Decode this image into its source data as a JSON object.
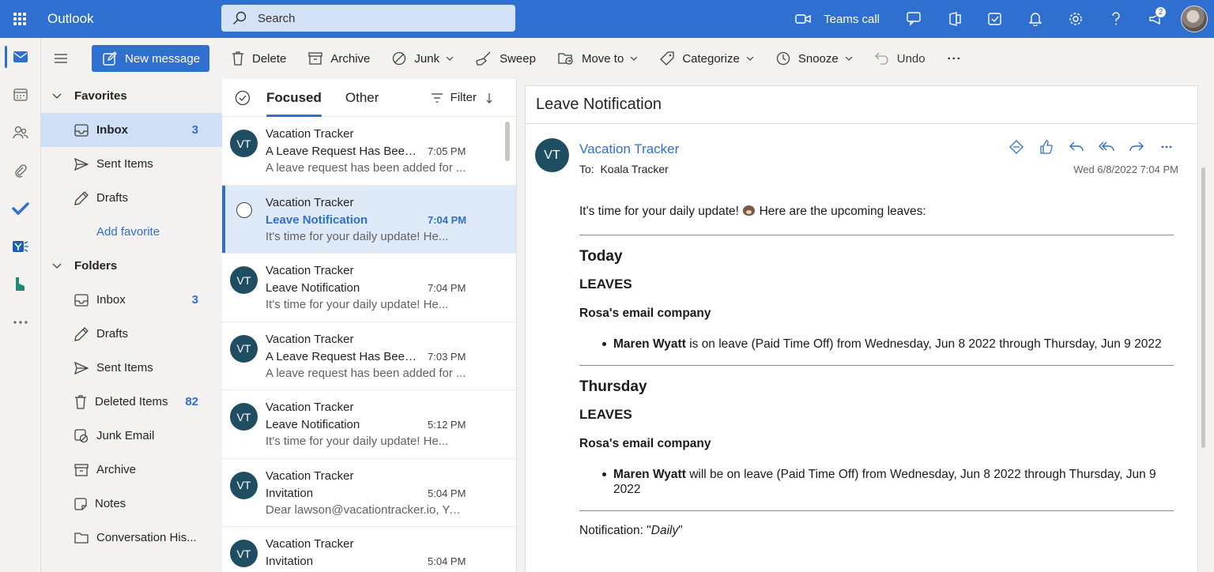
{
  "app": {
    "name": "Outlook"
  },
  "search": {
    "placeholder": "Search"
  },
  "topbar": {
    "teams_label": "Teams call",
    "notification_count": "2"
  },
  "commands": {
    "new_message": "New message",
    "delete": "Delete",
    "archive": "Archive",
    "junk": "Junk",
    "sweep": "Sweep",
    "move_to": "Move to",
    "categorize": "Categorize",
    "snooze": "Snooze",
    "undo": "Undo",
    "more": "···"
  },
  "folders": {
    "favorites_label": "Favorites",
    "favorites": [
      {
        "label": "Inbox",
        "count": "3"
      },
      {
        "label": "Sent Items",
        "count": ""
      },
      {
        "label": "Drafts",
        "count": ""
      }
    ],
    "add_favorite": "Add favorite",
    "folders_label": "Folders",
    "items": [
      {
        "label": "Inbox",
        "count": "3"
      },
      {
        "label": "Drafts",
        "count": ""
      },
      {
        "label": "Sent Items",
        "count": ""
      },
      {
        "label": "Deleted Items",
        "count": "82"
      },
      {
        "label": "Junk Email",
        "count": ""
      },
      {
        "label": "Archive",
        "count": ""
      },
      {
        "label": "Notes",
        "count": ""
      },
      {
        "label": "Conversation His...",
        "count": ""
      }
    ]
  },
  "list": {
    "tab_focused": "Focused",
    "tab_other": "Other",
    "filter": "Filter",
    "messages": [
      {
        "initials": "VT",
        "sender": "Vacation Tracker",
        "subject": "A Leave Request Has Been ...",
        "time": "7:05 PM",
        "preview": "A leave request has been added for ..."
      },
      {
        "initials": "VT",
        "sender": "Vacation Tracker",
        "subject": "Leave Notification",
        "time": "7:04 PM",
        "preview": "It's time for your daily update! He..."
      },
      {
        "initials": "VT",
        "sender": "Vacation Tracker",
        "subject": "Leave Notification",
        "time": "7:04 PM",
        "preview": "It's time for your daily update! He..."
      },
      {
        "initials": "VT",
        "sender": "Vacation Tracker",
        "subject": "A Leave Request Has Been ...",
        "time": "7:03 PM",
        "preview": "A leave request has been added for ..."
      },
      {
        "initials": "VT",
        "sender": "Vacation Tracker",
        "subject": "Leave Notification",
        "time": "5:12 PM",
        "preview": "It's time for your daily update! He..."
      },
      {
        "initials": "VT",
        "sender": "Vacation Tracker",
        "subject": "Invitation",
        "time": "5:04 PM",
        "preview": "Dear lawson@vacationtracker.io, You..."
      },
      {
        "initials": "VT",
        "sender": "Vacation Tracker",
        "subject": "Invitation",
        "time": "5:04 PM",
        "preview": ""
      }
    ]
  },
  "reading": {
    "title": "Leave Notification",
    "initials": "VT",
    "sender": "Vacation Tracker",
    "to_label": "To:",
    "to": "Koala Tracker",
    "date": "Wed 6/8/2022 7:04 PM",
    "intro_a": "It's time for your daily update!",
    "intro_b": "Here are the upcoming leaves:",
    "sections": [
      {
        "day": "Today",
        "leaves_label": "LEAVES",
        "company": "Rosa's email company",
        "person": "Maren Wyatt",
        "detail": "is on leave (Paid Time Off) from Wednesday, Jun 8 2022 through Thursday, Jun 9 2022"
      },
      {
        "day": "Thursday",
        "leaves_label": "LEAVES",
        "company": "Rosa's email company",
        "person": "Maren Wyatt",
        "detail": "will be on leave (Paid Time Off) from Wednesday, Jun 8 2022 through Thursday, Jun 9 2022"
      }
    ],
    "notification_prefix": "Notification: \"",
    "notification_value": "Daily",
    "notification_suffix": "\""
  },
  "colors": {
    "brand": "#2f6fd0",
    "avatar": "#1f4e63",
    "selected": "#dfeaf8"
  }
}
